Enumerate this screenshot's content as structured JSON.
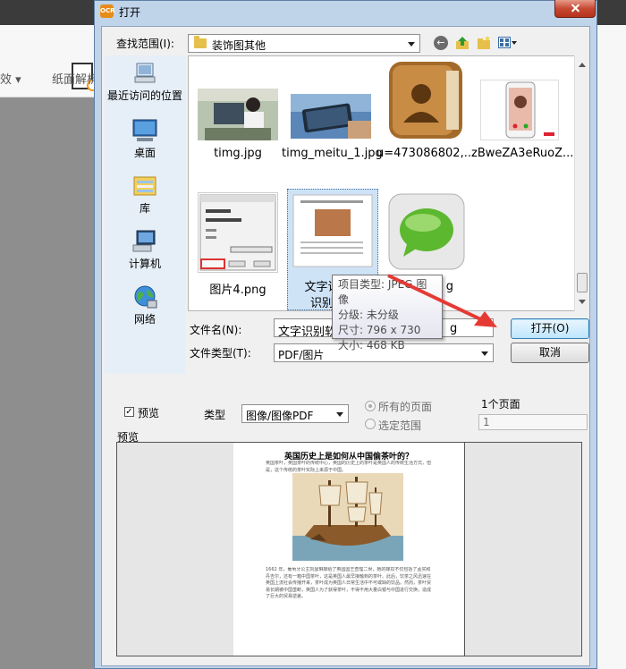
{
  "background_app": {
    "toolbar_labels": [
      "纸面解析",
      "纸面解"
    ],
    "left_label": "效 ▾"
  },
  "dialog": {
    "title": "打开",
    "lookin": {
      "label": "查找范围(I):",
      "value": "装饰图其他"
    },
    "places": [
      {
        "label": "最近访问的位置",
        "icon": "recent-places-icon"
      },
      {
        "label": "桌面",
        "icon": "desktop-icon"
      },
      {
        "label": "库",
        "icon": "library-icon"
      },
      {
        "label": "计算机",
        "icon": "computer-icon"
      },
      {
        "label": "网络",
        "icon": "network-icon"
      }
    ],
    "files": [
      {
        "name": "timg.jpg"
      },
      {
        "name": "timg_meitu_1.jpg"
      },
      {
        "name": "u=473086802,..."
      },
      {
        "name": "zBweZA3eRuoZ..."
      },
      {
        "name": "图片4.png"
      },
      {
        "name_line1": "文字识别软",
        "name_line2": "识别率高"
      },
      {
        "name": "g"
      }
    ],
    "tooltip": {
      "type": "项目类型: JPEG 图像",
      "rating": "分级: 未分级",
      "size": "尺寸: 796 x 730",
      "filesize": "大小: 468 KB"
    },
    "filename": {
      "label": "文件名(N):",
      "value": "文字识别软",
      "value_tail": "g"
    },
    "filetype": {
      "label": "文件类型(T):",
      "value": "PDF/图片"
    },
    "open_button": "打开(O)",
    "cancel_button": "取消",
    "preview_checkbox": {
      "label": "预览",
      "checked": true
    },
    "type": {
      "label": "类型",
      "value": "图像/图像PDF"
    },
    "page_options": {
      "all": "所有的页面",
      "range": "选定范围"
    },
    "page_count": "1个页面",
    "page_range_value": "1",
    "preview_label": "预览",
    "document": {
      "title": "英国历史上是如何从中国偷茶叶的？",
      "intro": "英国茶叶，英国茶叶的传统中心，英国的历史上的茶叶是英国人的传统生活方式，但是，这个传统的茶叶实际上来源于中国。",
      "body": "1662 年，葡萄牙公主凯瑟琳嫁给了英国国王查理二世，她的嫁妆不仅包括了孟买和丹吉尔，还有一箱中国茶叶，这是英国人最早接触到的茶叶。此后，饮茶之风迅速在英国上流社会传播开来，茶叶成为英国人日常生活中不可或缺的饮品。然而，茶叶贸易长期被中国垄断，英国人为了获得茶叶，不得不用大量白银与中国进行交换，造成了巨大的贸易逆差。"
    }
  }
}
